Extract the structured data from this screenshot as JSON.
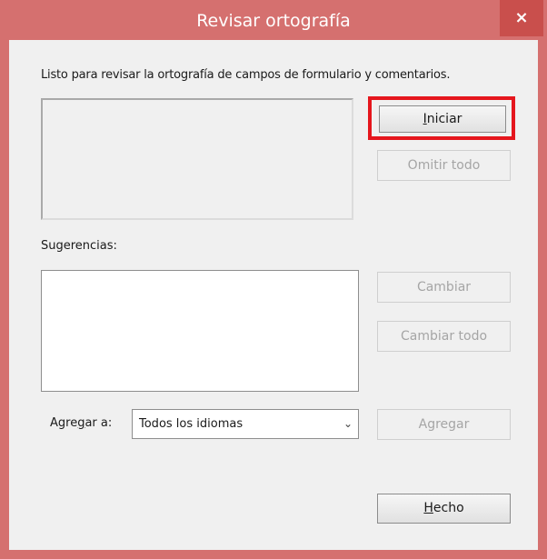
{
  "window": {
    "title": "Revisar ortografía",
    "close_glyph": "×",
    "frame_color": "#d5706f",
    "close_color": "#c94f4c"
  },
  "dialog": {
    "instruction": "Listo para revisar la ortografía de campos de formulario y comentarios.",
    "buttons": {
      "start": {
        "underline": "I",
        "rest": "niciar"
      },
      "ignore_all": "Omitir todo",
      "change": "Cambiar",
      "change_all": "Cambiar todo",
      "add": "Agregar",
      "done": {
        "underline": "H",
        "rest": "echo"
      }
    },
    "suggestions_label": "Sugerencias:",
    "add_to": {
      "before": "Agre",
      "underline": "g",
      "after": "ar a:"
    },
    "language_select": {
      "value": "Todos los idiomas",
      "arrow_icon": "chevron-down-icon"
    },
    "highlight_color": "#e5161d"
  }
}
